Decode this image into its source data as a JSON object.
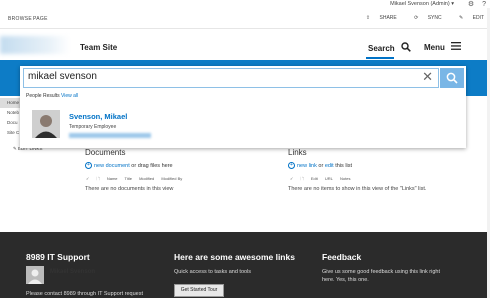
{
  "suite": {
    "user": "Mikael Svenson (Admin) ▾"
  },
  "ribbon": {
    "tabs": [
      "BROWSE",
      "PAGE"
    ],
    "actions": [
      "SHARE",
      "SYNC",
      "EDIT"
    ]
  },
  "topnav": {
    "site_title": "Team Site",
    "search_label": "Search",
    "menu_label": "Menu"
  },
  "leftnav": {
    "items": [
      "Home",
      "Noteb",
      "Docu",
      "Site C"
    ],
    "edit_links": "EDIT LINKS"
  },
  "search": {
    "value": "mikael svenson",
    "people_results_label": "People Results",
    "view_all": "View all",
    "person": {
      "name": "Svenson, Mikael",
      "title": "Temporary Employee"
    }
  },
  "documents": {
    "title": "Documents",
    "new_link": "new document",
    "or_text": " or drag files here",
    "columns": [
      "Name",
      "Title",
      "Modified",
      "Modified By"
    ],
    "empty": "There are no documents in this view"
  },
  "links": {
    "title": "Links",
    "new_link": "new link",
    "or": " or ",
    "edit": "edit",
    "this_list": " this list",
    "columns": [
      "Edit",
      "URL",
      "Notes"
    ],
    "empty": "There are no items to show in this view of the \"Links\" list."
  },
  "footer": {
    "support_title": "8989 IT Support",
    "support_name": "Mikael Svenson",
    "support_text": "Please contact 8989 through IT Support request",
    "links_title": "Here are some awesome links",
    "links_text": "Quick access to tasks and tools",
    "tour_button": "Get Started Tour",
    "feedback_title": "Feedback",
    "feedback_text_1": "Give us some good feedback using this link right",
    "feedback_text_2": "here. Yes, this one."
  },
  "colors": {
    "brand_blue": "#0d7cc6",
    "link_blue": "#0072c6",
    "footer_bg": "#2b2b2b"
  }
}
